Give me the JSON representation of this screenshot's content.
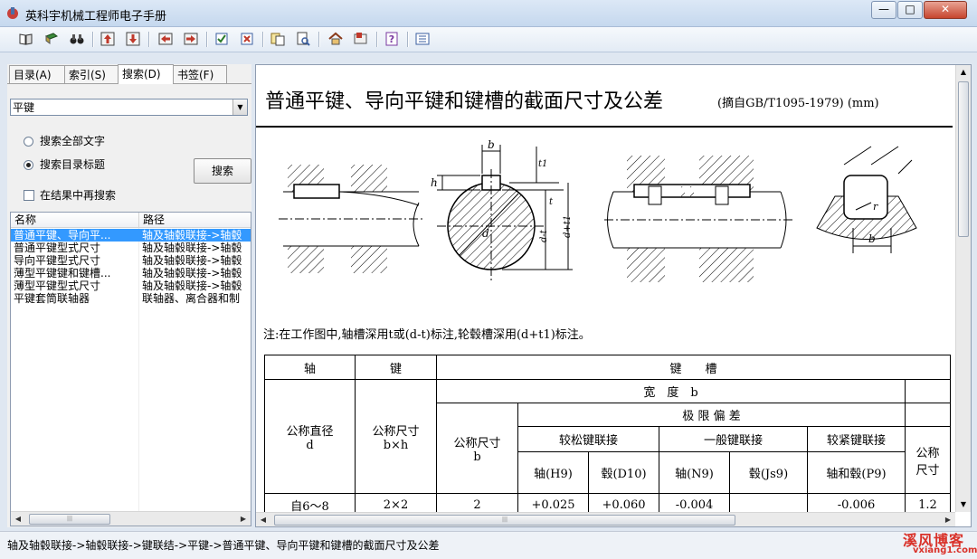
{
  "window": {
    "title": "英科宇机械工程师电子手册",
    "extra_title": "",
    "buttons": {
      "minimize": "—",
      "maximize": "□",
      "close": "✕"
    }
  },
  "toolbar": {
    "icons": [
      "book-open-icon",
      "book-icon",
      "binoculars-icon",
      "arrow-up-icon",
      "arrow-down-icon",
      "arrow-left-icon",
      "arrow-right-icon",
      "check-icon",
      "cancel-icon",
      "copy-icon",
      "print-preview-icon",
      "home-icon",
      "bookmark-icon",
      "help-icon",
      "list-icon"
    ]
  },
  "sidebar": {
    "tabs": [
      "目录(A)",
      "索引(S)",
      "搜索(D)",
      "书签(F)"
    ],
    "active_tab": "搜索(D)",
    "search_value": "平键",
    "radio_all": "搜索全部文字",
    "radio_titles": "搜索目录标题",
    "selected_radio": "搜索目录标题",
    "search_button": "搜索",
    "checkbox_label": "在结果中再搜索",
    "checkbox_checked": false,
    "columns": [
      "名称",
      "路径"
    ],
    "results": [
      {
        "name": "普通平键、导向平...",
        "path": "轴及轴毂联接->轴毂",
        "selected": true
      },
      {
        "name": "普通平键型式尺寸",
        "path": "轴及轴毂联接->轴毂",
        "selected": false
      },
      {
        "name": "导向平键型式尺寸",
        "path": "轴及轴毂联接->轴毂",
        "selected": false
      },
      {
        "name": "薄型平键键和键槽...",
        "path": "轴及轴毂联接->轴毂",
        "selected": false
      },
      {
        "name": "薄型平键型式尺寸",
        "path": "轴及轴毂联接->轴毂",
        "selected": false
      },
      {
        "name": "平键套筒联轴器",
        "path": "联轴器、离合器和制",
        "selected": false
      }
    ]
  },
  "content": {
    "title": "普通平键、导向平键和键槽的截面尺寸及公差",
    "source_note": "(摘自GB/T1095-1979)  (mm)",
    "figure_labels": {
      "b": "b",
      "t1": "t1",
      "h": "h",
      "t": "t",
      "d": "d",
      "d_minus_t": "d-t",
      "d_plus_t1": "d+t1",
      "r": "r",
      "b2": "b"
    },
    "caption": "注:在工作图中,轴槽深用t或(d-t)标注,轮毂槽深用(d+t1)标注。",
    "table": {
      "h_shaft": "轴",
      "h_key": "键",
      "h_keyway": "键　　槽",
      "h_width": "宽　度　b",
      "h_limit": "极 限 偏 差",
      "h_loose": "较松键联接",
      "h_normal": "一般键联接",
      "h_tight": "较紧键联接",
      "h_diameter": "公称直径\nd",
      "h_key_size": "公称尺寸\nb×h",
      "h_nominal_b": "公称尺寸\nb",
      "h_nominal_short": "公称\n尺寸",
      "c_shaft_h9": "轴(H9)",
      "c_hub_d10": "毂(D10)",
      "c_shaft_n9": "轴(N9)",
      "c_hub_js9": "毂(Js9)",
      "c_shaft_hub_p9": "轴和毂(P9)",
      "r1_d": "自6～8",
      "r1_key": "2×2",
      "r1_b": "2",
      "r1_h9": "+0.025",
      "r1_d10": "+0.060",
      "r1_n9": "-0.004",
      "r1_js9": "",
      "r1_p9": "-0.006",
      "r1_last": "1.2"
    }
  },
  "statusbar": {
    "path": "轴及轴毂联接->轴毂联接->键联结->平键->普通平键、导向平键和键槽的截面尺寸及公差"
  },
  "watermark": {
    "line1": "溪风博客",
    "line2": "vxiang1.com"
  }
}
